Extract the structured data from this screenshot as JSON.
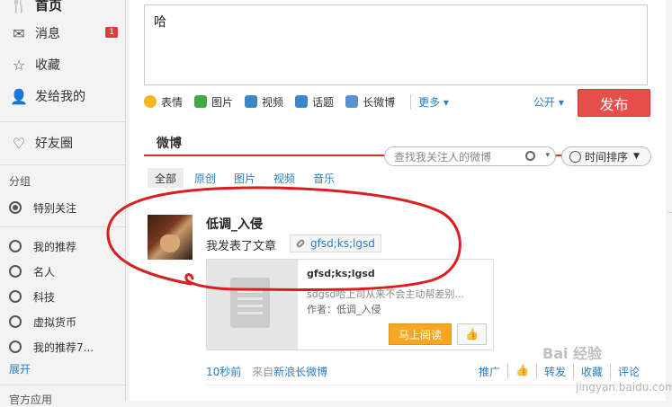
{
  "sidebar": {
    "home": "首页",
    "messages": "消息",
    "messages_badge": "1",
    "favorites": "收藏",
    "sent_to_me": "发给我的",
    "friends_circle": "好友圈",
    "group_title": "分组",
    "groups": [
      "特别关注",
      "我的推荐",
      "名人",
      "科技",
      "虚拟货币",
      "我的推荐7..."
    ],
    "expand": "展开",
    "apps_title": "官方应用"
  },
  "compose": {
    "text": "哈",
    "tools": [
      "表情",
      "图片",
      "视频",
      "话题",
      "长微博"
    ],
    "more": "更多",
    "visibility": "公开",
    "publish": "发布"
  },
  "feed": {
    "title": "微博",
    "search_placeholder": "查找我关注人的微博",
    "sort": "时间排序",
    "tabs": [
      "全部",
      "原创",
      "图片",
      "视频",
      "音乐"
    ]
  },
  "post": {
    "author": "低调_入侵",
    "text": "我发表了文章",
    "tag": "gfsd;ks;lgsd",
    "article": {
      "title": "gfsd;ks;lgsd",
      "excerpt": "sdgsd哈上司从来不会主动帮差别...",
      "author": "作者：低调_入侵",
      "read_btn": "马上阅读"
    },
    "time": "10秒前",
    "source_prefix": "来自",
    "source": "新浪长微博",
    "actions": [
      "推广",
      "转发",
      "收藏",
      "评论"
    ]
  },
  "watermark": {
    "brand": "Bai 经验",
    "url": "jingyan.baidu.com"
  },
  "colors": {
    "accent_red": "#d6302b",
    "link_blue": "#2a7ec4",
    "publish_btn": "#e94f4a",
    "read_btn": "#f6a623"
  }
}
